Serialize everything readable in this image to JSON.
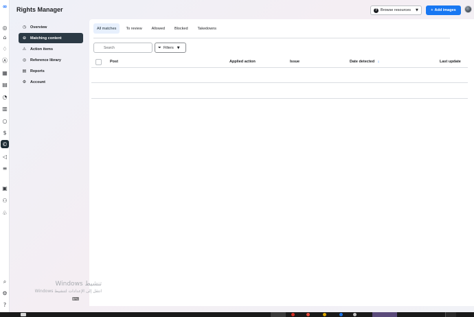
{
  "app": {
    "title": "Rights Manager"
  },
  "header": {
    "browse_label": "Browse resources",
    "add_label": "Add images",
    "add_prefix": "+"
  },
  "rail_icons": [
    "meta-logo",
    "home-icon",
    "bell-icon",
    "compass-icon",
    "grid-icon",
    "layers-icon",
    "chart-icon",
    "circle-icon",
    "dollar-icon",
    "rights-icon",
    "megaphone-icon",
    "menu-icon",
    "building-icon",
    "people-icon",
    "tree-icon",
    "search-icon",
    "gear-icon",
    "help-icon"
  ],
  "sidebar": {
    "items": [
      {
        "label": "Overview",
        "icon": "clock-icon"
      },
      {
        "label": "Matching content",
        "icon": "matching-icon"
      },
      {
        "label": "Action items",
        "icon": "warning-icon"
      },
      {
        "label": "Reference library",
        "icon": "library-icon"
      },
      {
        "label": "Reports",
        "icon": "report-icon"
      },
      {
        "label": "Account",
        "icon": "account-icon"
      }
    ]
  },
  "main": {
    "tabs": [
      {
        "label": "All matches"
      },
      {
        "label": "To review"
      },
      {
        "label": "Allowed"
      },
      {
        "label": "Blocked"
      },
      {
        "label": "Takedowns"
      }
    ],
    "search_placeholder": "Search",
    "filters_label": "Filters",
    "columns": {
      "post": "Post",
      "applied_action": "Applied action",
      "issue": "Issue",
      "date_detected": "Date detected",
      "last_update": "Last update"
    },
    "sort_indicator": "↓"
  },
  "watermark": {
    "line1": "Windows تنشيط",
    "line2": "Windows انتقل إلى الإعدادات لتنشيط"
  },
  "colors": {
    "accent": "#1877f2",
    "sidebar_active": "#2c3a45",
    "tab_active_bg": "#e7f0fd"
  }
}
